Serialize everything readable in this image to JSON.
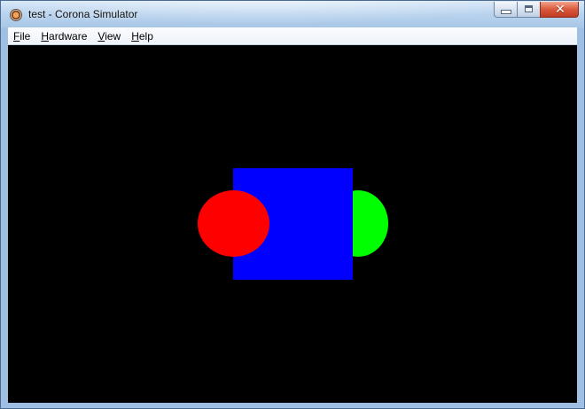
{
  "window": {
    "title": "test - Corona Simulator",
    "close_glyph": "✕"
  },
  "menu": {
    "items": [
      {
        "label": "File",
        "mnemonic": "F",
        "rest": "ile"
      },
      {
        "label": "Hardware",
        "mnemonic": "H",
        "rest": "ardware"
      },
      {
        "label": "View",
        "mnemonic": "V",
        "rest": "iew"
      },
      {
        "label": "Help",
        "mnemonic": "H",
        "rest": "elp"
      }
    ]
  },
  "canvas": {
    "background": "#000000",
    "shapes": [
      {
        "name": "green-circle",
        "color": "#00ff00"
      },
      {
        "name": "blue-square",
        "color": "#0000ff"
      },
      {
        "name": "red-circle",
        "color": "#ff0000"
      }
    ]
  },
  "icons": {
    "app": "corona-app-icon",
    "minimize": "minimize-icon",
    "maximize": "maximize-icon",
    "close": "close-icon"
  }
}
